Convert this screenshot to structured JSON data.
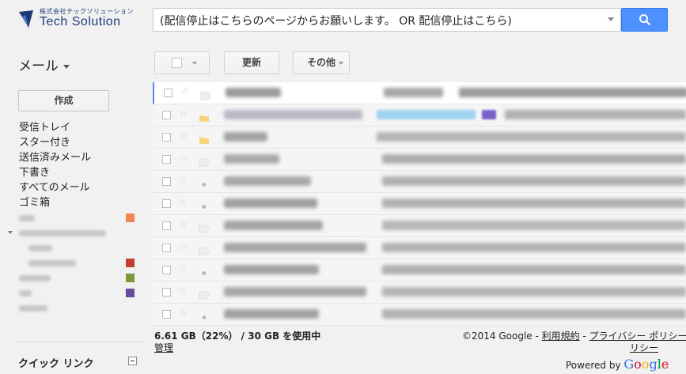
{
  "brand": {
    "company_small": "株式会社テックソリューション",
    "name": "Tech Solution"
  },
  "search": {
    "query": "(配信停止はこちらのページからお願いします。 OR 配信停止はこちら)"
  },
  "left_nav": {
    "mail_title": "メール",
    "compose_label": "作成",
    "items": [
      {
        "label": "受信トレイ"
      },
      {
        "label": "スター付き"
      },
      {
        "label": "送信済みメール"
      },
      {
        "label": "下書き"
      },
      {
        "label": "すべてのメール"
      },
      {
        "label": "ゴミ箱"
      }
    ],
    "label_colors": [
      "#f2864f",
      "#c63c34",
      "#7a9a3c",
      "#6a4aa0"
    ],
    "quick_links_label": "クイック リンク"
  },
  "toolbar": {
    "refresh_label": "更新",
    "more_label": "その他"
  },
  "colors": {
    "accent": "#4d90fe",
    "selected_tag": "#9fd3ef",
    "purple_tag": "#7a5fc9",
    "folder_yellow": "#f6d57b"
  },
  "footer": {
    "usage": "6.61 GB（22%） / 30 GB を使用中",
    "manage": "管理",
    "copyright": "©2014 Google - ",
    "terms": "利用規約",
    "sep": " - ",
    "privacy": "プライバシー ポリシー",
    "privacy_cont": "リシー",
    "powered_by": "Powered by ",
    "google": "Google"
  }
}
